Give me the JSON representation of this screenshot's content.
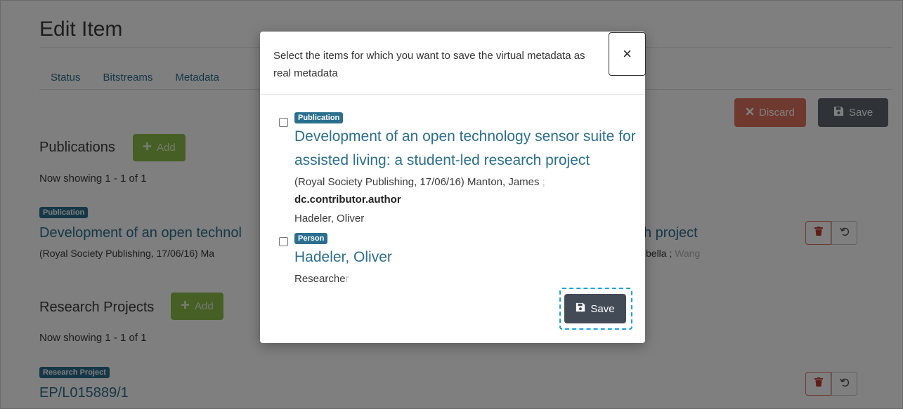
{
  "page": {
    "title": "Edit Item",
    "tabs": [
      "Status",
      "Bitstreams",
      "Metadata"
    ],
    "discard_label": "Discard",
    "save_label": "Save"
  },
  "publications": {
    "heading": "Publications",
    "add_label": "Add",
    "now_showing": "Now showing 1 - 1 of 1",
    "item": {
      "badge": "Publication",
      "title_left": "Development of an open technol",
      "title_right": "h project",
      "meta_left": "(Royal Society Publishing, 17/06/16) Ma",
      "meta_right": "bella ; ",
      "meta_right_fade": "Wang"
    }
  },
  "research_projects": {
    "heading": "Research Projects",
    "add_label": "Add",
    "now_showing": "Now showing 1 - 1 of 1",
    "item": {
      "badge": "Research Project",
      "title": "EP/L015889/1"
    }
  },
  "modal": {
    "title": "Select the items for which you want to save the virtual metadata as real metadata",
    "close_label": "×",
    "items": [
      {
        "badge": "Publication",
        "title": "Development of an open technology sensor suite for assisted living: a student-led research project",
        "meta": "(Royal Society Publishing, 17/06/16) Manton, James",
        "meta_fade": " ;",
        "field_name": "dc.contributor.author",
        "field_value": "Hadeler, Oliver"
      },
      {
        "badge": "Person",
        "title": "Hadeler, Oliver",
        "subtitle": "Researche",
        "subtitle_fade": "r"
      }
    ],
    "save_label": "Save"
  },
  "colors": {
    "link": "#2b6f8f",
    "add_button": "#8bbf4a",
    "discard_button": "#e1735e",
    "save_button": "#5f6770",
    "modal_save_button": "#434b56",
    "focus_ring": "#1aa3d9"
  },
  "icons": {
    "discard": "times-icon",
    "save": "floppy-disk-icon",
    "add": "plus-icon",
    "delete": "trash-icon",
    "undo": "undo-icon"
  }
}
